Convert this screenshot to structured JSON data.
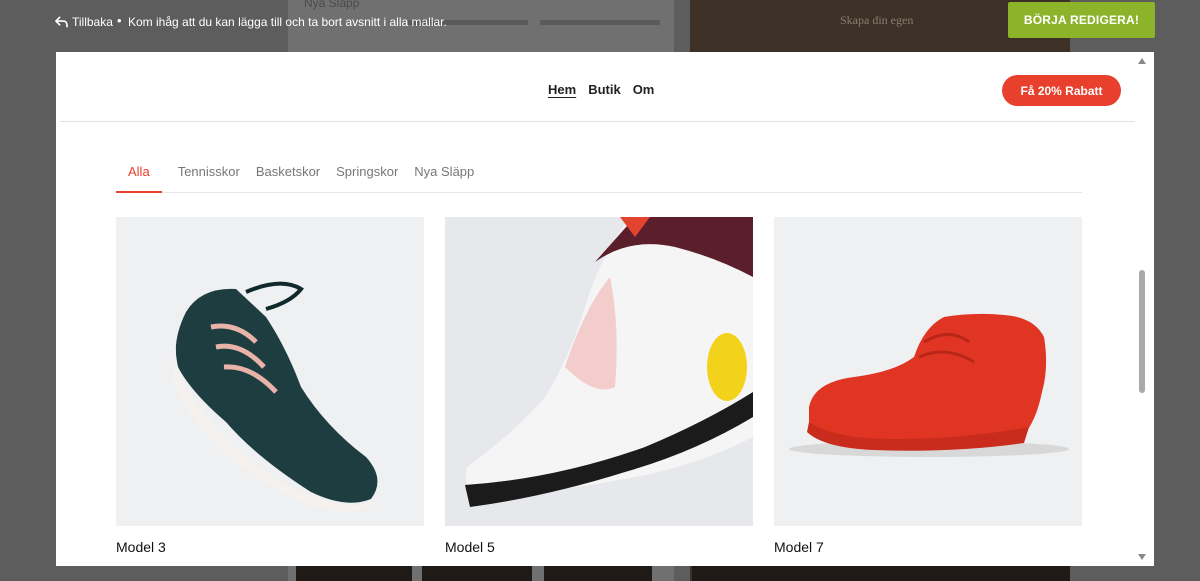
{
  "editor": {
    "back_label": "Tillbaka",
    "separator": "•",
    "hint": "Kom ihåg att du kan lägga till och ta bort avsnitt i alla mallar.",
    "start_button": "BÖRJA REDIGERA!",
    "accent": "#8cb32a"
  },
  "background": {
    "left_tab": "Nya Släpp",
    "right_text": "Skapa din egen"
  },
  "site": {
    "nav": [
      "Hem",
      "Butik",
      "Om"
    ],
    "active_nav": "Hem",
    "promo_label": "Få 20% Rabatt",
    "accent": "#e8402c"
  },
  "tabs": {
    "items": [
      "Alla",
      "Tennisskor",
      "Basketskor",
      "Springskor",
      "Nya Släpp"
    ],
    "active": "Alla"
  },
  "products": [
    {
      "title": "Model 3",
      "image": "dark-green-sneaker-image"
    },
    {
      "title": "Model 5",
      "image": "white-running-shoe-image"
    },
    {
      "title": "Model 7",
      "image": "red-basketball-shoe-image"
    }
  ]
}
